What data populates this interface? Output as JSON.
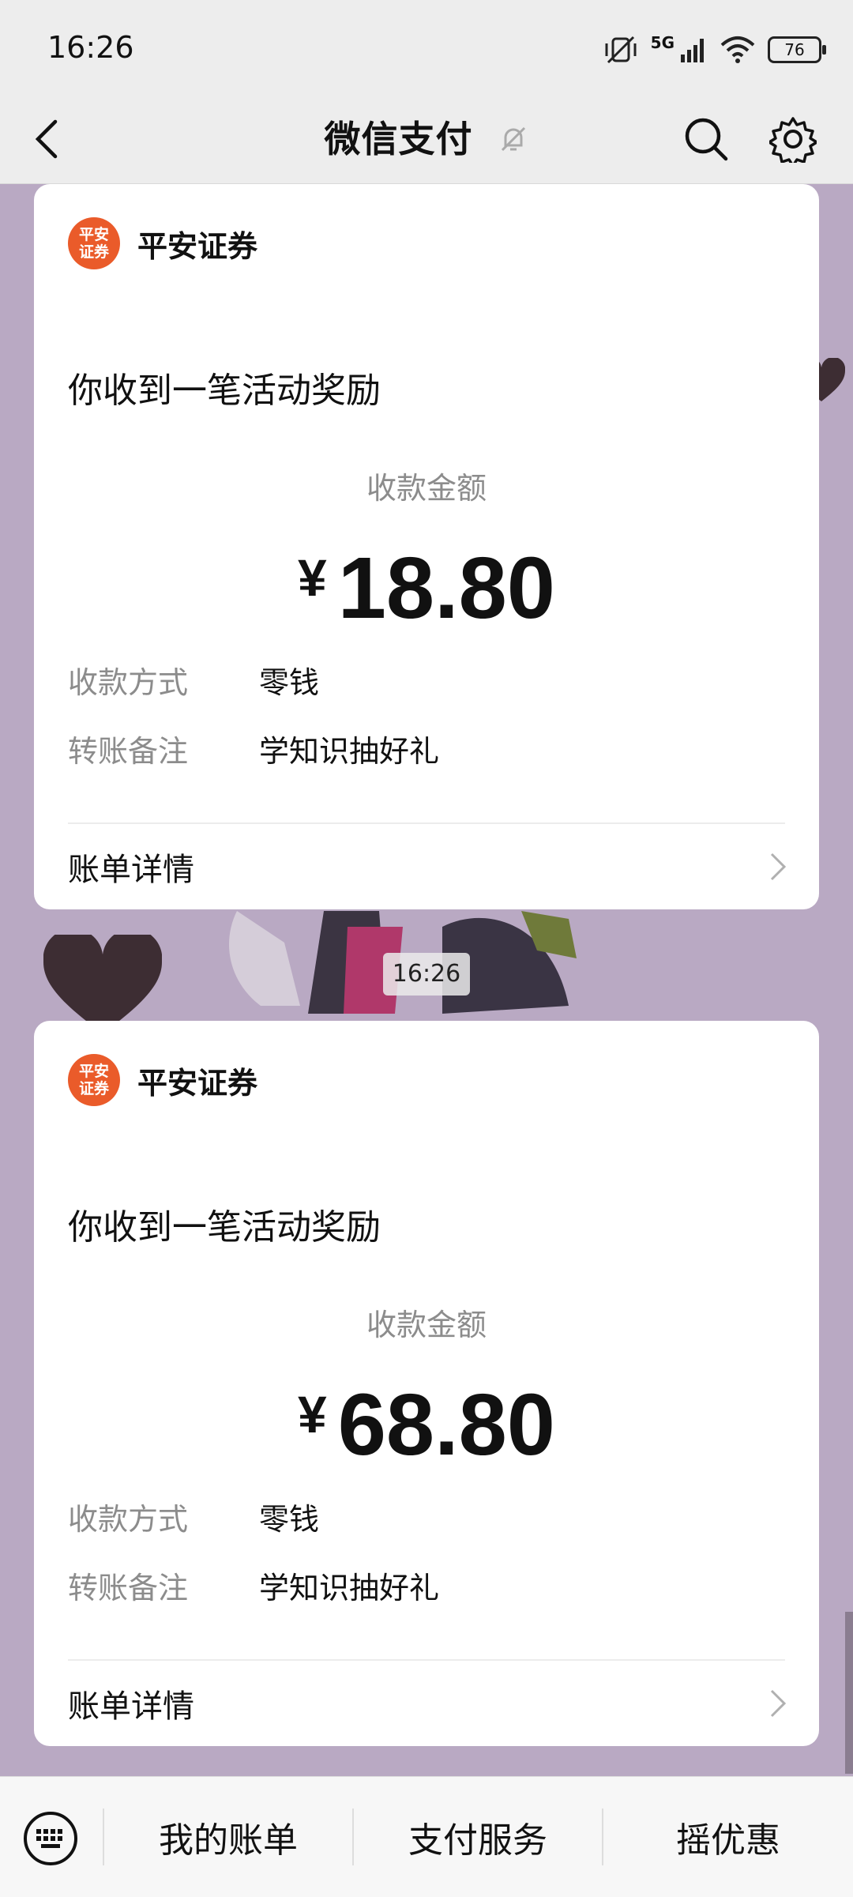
{
  "status_bar": {
    "time": "16:26",
    "network": "5G",
    "battery": "76"
  },
  "nav": {
    "title": "微信支付"
  },
  "cards": [
    {
      "merchant_logo_text": "平安\n证券",
      "merchant": "平安证券",
      "headline": "你收到一笔活动奖励",
      "amount_label": "收款金额",
      "currency": "¥",
      "amount": "18.80",
      "method_label": "收款方式",
      "method_value": "零钱",
      "note_label": "转账备注",
      "note_value": "学知识抽好礼",
      "detail_label": "账单详情"
    },
    {
      "merchant_logo_text": "平安\n证券",
      "merchant": "平安证券",
      "headline": "你收到一笔活动奖励",
      "amount_label": "收款金额",
      "currency": "¥",
      "amount": "68.80",
      "method_label": "收款方式",
      "method_value": "零钱",
      "note_label": "转账备注",
      "note_value": "学知识抽好礼",
      "detail_label": "账单详情"
    }
  ],
  "timestamp": "16:26",
  "bottom_menu": {
    "item1": "我的账单",
    "item2": "支付服务",
    "item3": "摇优惠"
  },
  "icons": {
    "back": "chevron-left-icon",
    "mute": "bell-off-icon",
    "search": "search-icon",
    "settings": "gear-icon",
    "keyboard": "keyboard-icon",
    "chevron": "chevron-right-icon"
  },
  "colors": {
    "logo": "#ea5b2a",
    "chat_background": "#b9a9c3"
  }
}
